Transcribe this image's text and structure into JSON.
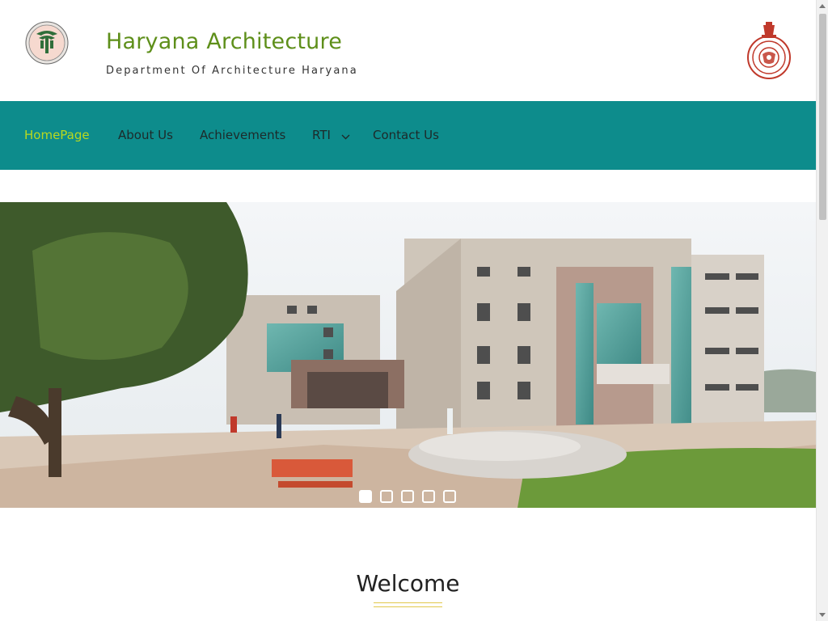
{
  "header": {
    "logo_icon": "department-of-architecture-logo",
    "title": "Haryana Architecture",
    "tagline": "Department Of Architecture Haryana",
    "emblem_icon": "haryana-state-emblem"
  },
  "nav": {
    "items": [
      {
        "label": "HomePage",
        "active": true
      },
      {
        "label": "About Us",
        "active": false
      },
      {
        "label": "Achievements",
        "active": false
      },
      {
        "label": "RTI",
        "active": false,
        "has_dropdown": true
      },
      {
        "label": "Contact Us",
        "active": false
      }
    ]
  },
  "slider": {
    "slide_count": 5,
    "active_slide": 1
  },
  "welcome": {
    "title": "Welcome"
  },
  "colors": {
    "brand_green": "#5e8f1a",
    "nav_teal": "#0d8c8c",
    "nav_active": "#b9d91f",
    "underline_gold": "#e2c84a"
  }
}
